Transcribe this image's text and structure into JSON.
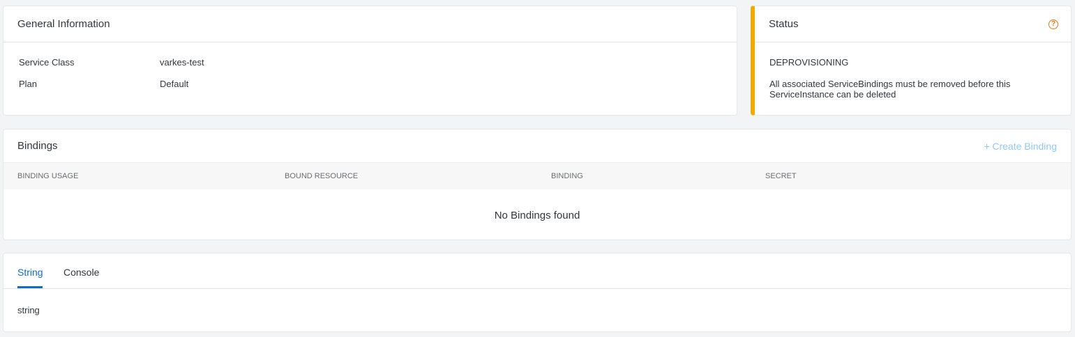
{
  "general": {
    "title": "General Information",
    "rows": [
      {
        "label": "Service Class",
        "value": "varkes-test"
      },
      {
        "label": "Plan",
        "value": "Default"
      }
    ]
  },
  "status": {
    "title": "Status",
    "help_icon": "help-circle-icon",
    "state": "DEPROVISIONING",
    "message": "All associated ServiceBindings must be removed before this ServiceInstance can be deleted",
    "accent_color": "#f0ab00"
  },
  "bindings": {
    "title": "Bindings",
    "create_label": "+ Create Binding",
    "columns": [
      "BINDING USAGE",
      "BOUND RESOURCE",
      "BINDING",
      "SECRET"
    ],
    "empty_message": "No Bindings found"
  },
  "tabs": {
    "items": [
      {
        "label": "String",
        "active": true
      },
      {
        "label": "Console",
        "active": false
      }
    ],
    "content": "string",
    "active_color": "#0a6ed1"
  }
}
